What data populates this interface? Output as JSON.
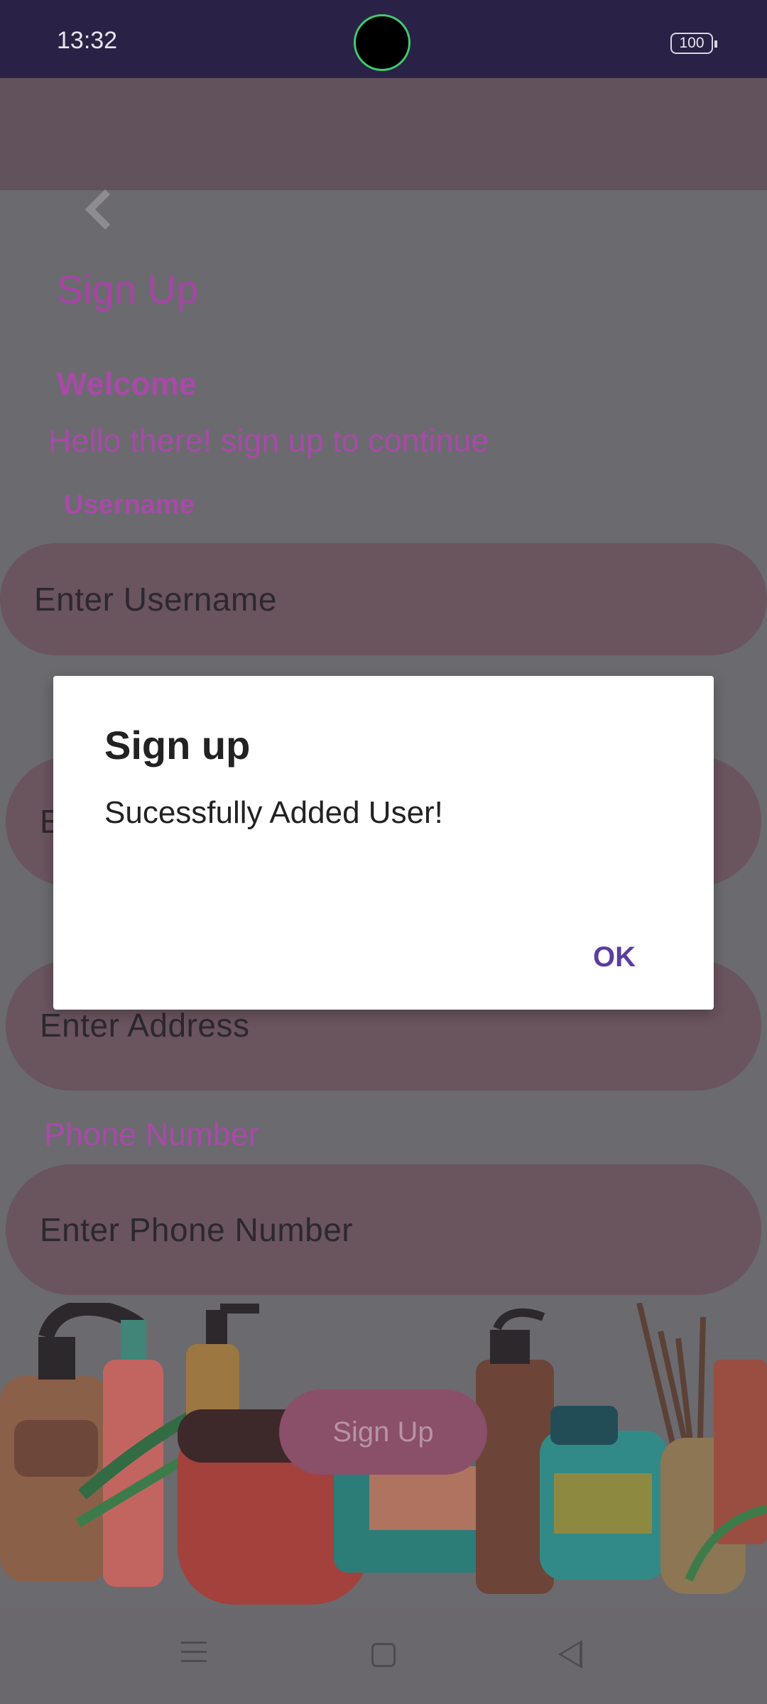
{
  "status_bar": {
    "time": "13:32",
    "battery": "100"
  },
  "screen": {
    "title": "Sign Up",
    "welcome": "Welcome",
    "subtitle": "Hello there! sign up to continue",
    "username_label": "Username",
    "username_placeholder": "Enter Username",
    "hidden_field_prefix": "E",
    "address_placeholder": "Enter Address",
    "phone_label": "Phone Number",
    "phone_placeholder": "Enter Phone Number",
    "signup_button": "Sign Up"
  },
  "dialog": {
    "title": "Sign up",
    "message": "Sucessfully Added User!",
    "ok_label": "OK"
  },
  "icons": {
    "back": "chevron-left-icon",
    "menu": "menu-icon",
    "home": "home-icon",
    "nav_back": "triangle-back-icon"
  }
}
